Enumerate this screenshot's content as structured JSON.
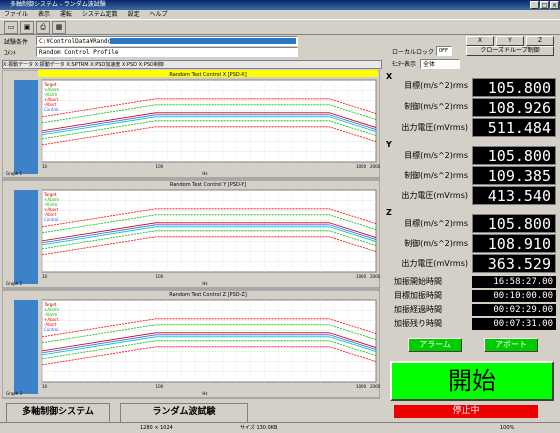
{
  "window": {
    "title": "多軸制御システム - ランダム波試験"
  },
  "menu": [
    "ファイル",
    "表示",
    "運転",
    "システム定数",
    "設定",
    "ヘルプ"
  ],
  "test_info": {
    "file_label": "試験条件",
    "file_path": "C:¥ControlData¥RandomControl",
    "comment_label": "ｺﾒﾝﾄ",
    "comment_value": "Random Control Profile"
  },
  "local_lock": {
    "label": "ローカルロック",
    "value": "OFF"
  },
  "axis_buttons": [
    "X",
    "Y",
    "Z"
  ],
  "close_group_button": "クローズドループ制御",
  "graph_tabs_text": "X:振動データ  X:振動データ  X:SPTRM  X:PSD加速度  X:PSD  X:PSD制御",
  "monitor": {
    "label": "ﾓﾆﾀｰ表示",
    "value": "全体"
  },
  "charts": [
    {
      "caption": "Random Test Control X [PSD-X]",
      "footer": "Graph 1",
      "xticks": [
        "10",
        "100",
        "1000",
        "2000"
      ],
      "xlabel": "Hz"
    },
    {
      "caption": "Random Test Control Y [PSD-Y]",
      "footer": "Graph 2",
      "xticks": [
        "10",
        "100",
        "1000",
        "2000"
      ],
      "xlabel": "Hz"
    },
    {
      "caption": "Random Test Control Z [PSD-Z]",
      "footer": "Graph 3",
      "xticks": [
        "10",
        "100",
        "1000",
        "2000"
      ],
      "xlabel": "Hz"
    }
  ],
  "legend": [
    "Target",
    "+Alarm",
    "-Alarm",
    "+Abort",
    "-Abort",
    "Control"
  ],
  "axes": [
    {
      "name": "X",
      "rows": [
        {
          "label": "目標(m/s^2)rms",
          "value": "105.800"
        },
        {
          "label": "制御(m/s^2)rms",
          "value": "108.926"
        },
        {
          "label": "出力電圧(mVrms)",
          "value": "511.484"
        }
      ]
    },
    {
      "name": "Y",
      "rows": [
        {
          "label": "目標(m/s^2)rms",
          "value": "105.800"
        },
        {
          "label": "制御(m/s^2)rms",
          "value": "109.385"
        },
        {
          "label": "出力電圧(mVrms)",
          "value": "413.540"
        }
      ]
    },
    {
      "name": "Z",
      "rows": [
        {
          "label": "目標(m/s^2)rms",
          "value": "105.800"
        },
        {
          "label": "制御(m/s^2)rms",
          "value": "108.910"
        },
        {
          "label": "出力電圧(mVrms)",
          "value": "363.529"
        }
      ]
    }
  ],
  "times": [
    {
      "label": "加振開始時間",
      "value": "16:58:27.00"
    },
    {
      "label": "目標加振時間",
      "value": "00:10:00.00"
    },
    {
      "label": "加振経過時間",
      "value": "00:02:29.00"
    },
    {
      "label": "加振残り時間",
      "value": "00:07:31.00"
    }
  ],
  "alarm_button": "アラーム",
  "abort_button": "アボート",
  "start_button": "開始",
  "stop_status": "停止中",
  "bottom": {
    "system": "多軸制御システム",
    "test": "ランダム波試験"
  },
  "status": {
    "left": "1280 × 1024",
    "mid": "サイズ 130.0KB",
    "zoom": "100%"
  },
  "colors": {
    "target": "#c00000",
    "alarm": "#00c000",
    "abort": "#ff0000",
    "control": "#4060ff",
    "control2": "#00c0c0"
  }
}
